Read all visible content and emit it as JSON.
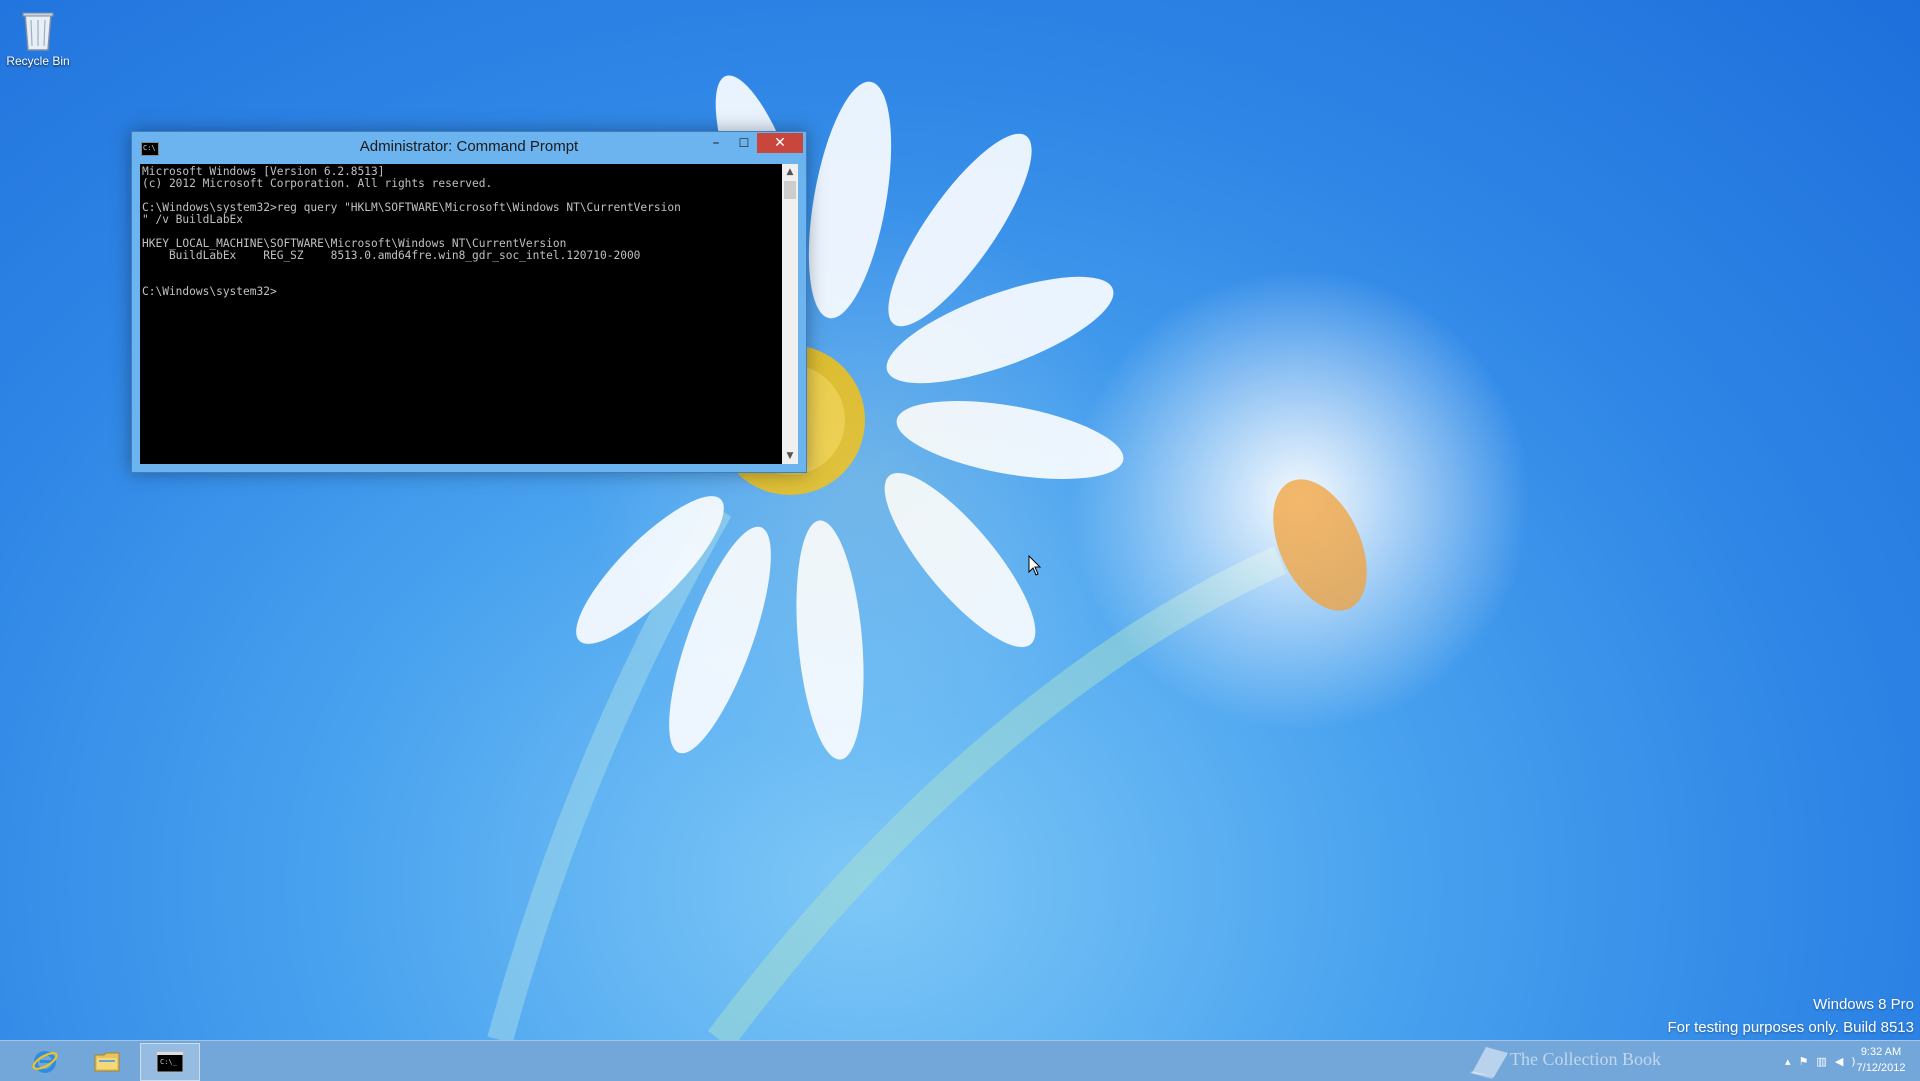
{
  "desktop": {
    "icons": [
      {
        "label": "Recycle Bin",
        "icon": "recycle-bin-icon"
      }
    ]
  },
  "window": {
    "title": "Administrator: Command Prompt",
    "icon": "cmd-icon",
    "controls": {
      "minimize": "–",
      "maximize": "☐",
      "close": "✕"
    },
    "console_lines": [
      "Microsoft Windows [Version 6.2.8513]",
      "(c) 2012 Microsoft Corporation. All rights reserved.",
      "",
      "C:\\Windows\\system32>reg query \"HKLM\\SOFTWARE\\Microsoft\\Windows NT\\CurrentVersion",
      "\" /v BuildLabEx",
      "",
      "HKEY_LOCAL_MACHINE\\SOFTWARE\\Microsoft\\Windows NT\\CurrentVersion",
      "    BuildLabEx    REG_SZ    8513.0.amd64fre.win8_gdr_soc_intel.120710-2000",
      "",
      "",
      "C:\\Windows\\system32>"
    ]
  },
  "watermark": {
    "edition": "Windows 8 Pro",
    "build_notice": "For testing purposes only. Build 8513"
  },
  "taskbar": {
    "apps": [
      {
        "name": "Internet Explorer",
        "icon": "internet-explorer-icon"
      },
      {
        "name": "File Explorer",
        "icon": "file-explorer-icon"
      },
      {
        "name": "Command Prompt",
        "icon": "cmd-icon",
        "active": true
      }
    ],
    "tray": {
      "overlay_text": "The Collection Book",
      "icons": [
        "show-hidden-icons",
        "flag-icon",
        "network-icon",
        "volume-icon"
      ],
      "time": "9:32 AM",
      "date": "7/12/2012"
    }
  },
  "colors": {
    "titlebar": "#6bb4ef",
    "close_button": "#c9463c",
    "console_bg": "#000000",
    "console_text": "#c0c0c0",
    "taskbar": "#5a96d2"
  }
}
